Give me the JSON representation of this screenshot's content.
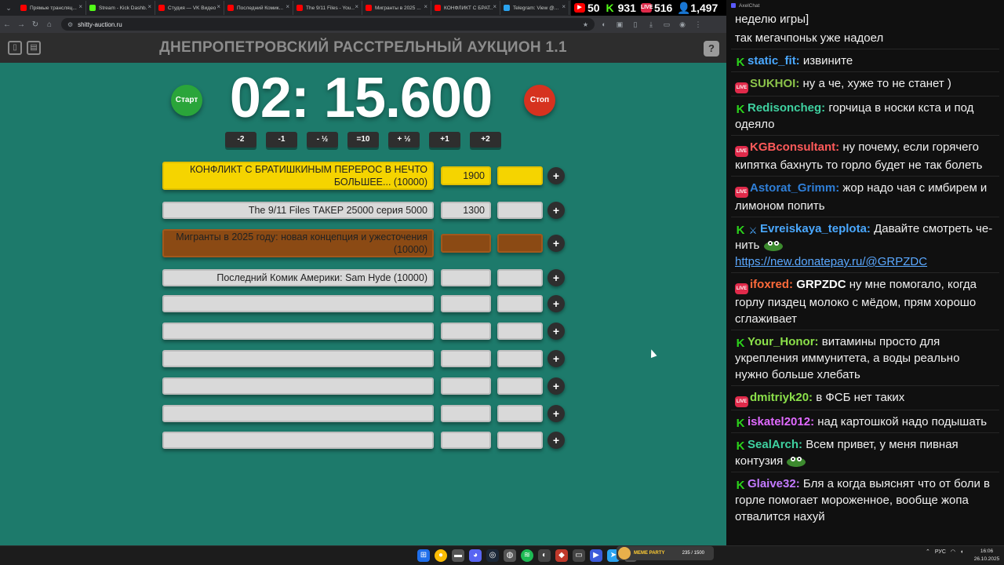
{
  "browser": {
    "tabs": [
      {
        "label": "Прямые трансляц...",
        "color": "#ff0000"
      },
      {
        "label": "Stream - Kick Dashb...",
        "color": "#53fc18"
      },
      {
        "label": "Студия — VK Видео",
        "color": "#ff0000"
      },
      {
        "label": "Последний Комик...",
        "color": "#ff0000"
      },
      {
        "label": "The 9/11 Files - You...",
        "color": "#ff0000"
      },
      {
        "label": "Мигранты в 2025 ...",
        "color": "#ff0000"
      },
      {
        "label": "КОНФЛИКТ С БРАТ...",
        "color": "#ff0000"
      },
      {
        "label": "Telegram: View @...",
        "color": "#2aa3ef"
      }
    ],
    "url": "shitty-auction.ru"
  },
  "stream_stats": {
    "youtube": "50",
    "kick": "931",
    "vk": "516",
    "total": "1,497"
  },
  "header": {
    "title": "ДНЕПРОПЕТРОВСКИЙ РАССТРЕЛЬНЫЙ АУКЦИОН 1.1",
    "help": "?"
  },
  "timer": {
    "value": "02: 15.600",
    "start": "Старт",
    "stop": "Стоп",
    "adjust": [
      "-2",
      "-1",
      "- ½",
      "=10",
      "+ ½",
      "+1",
      "+2"
    ]
  },
  "lots": [
    {
      "name": "КОНФЛИКТ С БРАТИШКИНЫМ ПЕРЕРОС В НЕЧТО БОЛЬШЕЕ... (10000)",
      "amount": "1900",
      "style": "yellow"
    },
    {
      "name": "The 9/11 Files ТАКЕР 25000 серия 5000",
      "amount": "1300",
      "style": "gray"
    },
    {
      "name": "Мигранты в 2025 году: новая концепция и ужесточения (10000)",
      "amount": "",
      "style": "brown"
    },
    {
      "name": "Последний Комик Америки: Sam Hyde (10000)",
      "amount": "",
      "style": "gray"
    },
    {
      "name": "",
      "amount": "",
      "style": "gray"
    },
    {
      "name": "",
      "amount": "",
      "style": "gray"
    },
    {
      "name": "",
      "amount": "",
      "style": "gray"
    },
    {
      "name": "",
      "amount": "",
      "style": "gray"
    },
    {
      "name": "",
      "amount": "",
      "style": "gray"
    },
    {
      "name": "",
      "amount": "",
      "style": "gray"
    }
  ],
  "plus_label": "+",
  "chat": {
    "window_title": "AxelChat",
    "messages": [
      {
        "platform": "",
        "nick": "",
        "color": "#ffffff",
        "text": "неделю игры]",
        "cont": true
      },
      {
        "platform": "",
        "nick": "",
        "color": "#ffffff",
        "text": "так мегачпоньк уже надоел",
        "cont": true
      },
      {
        "platform": "kick",
        "nick": "static_fit:",
        "color": "#4aa8ff",
        "text": "извините"
      },
      {
        "platform": "vk",
        "nick": "SUKHOI:",
        "color": "#8bc34a",
        "text": "ну а че, хуже то не станет )"
      },
      {
        "platform": "kick",
        "nick": "Redisoncheg:",
        "color": "#3fd1a0",
        "text": "горчица в носки кста и под одеяло"
      },
      {
        "platform": "vk",
        "nick": "KGBconsultant:",
        "color": "#ff5a5a",
        "text": "ну почему, если горячего кипятка бахнуть то горло будет не так болеть"
      },
      {
        "platform": "vk",
        "nick": "Astorat_Grimm:",
        "color": "#2f7fd8",
        "text": "жор надо чая с имбирем и лимоном попить"
      },
      {
        "platform": "kick",
        "nick": "Evreiskaya_teplota:",
        "color": "#4aa8ff",
        "text": "Давайте смотреть че-нить",
        "emote": true,
        "link": "https://new.donatepay.ru/@GRPZDC",
        "sword": true
      },
      {
        "platform": "vk",
        "nick": "ifoxred:",
        "color": "#ff6a3a",
        "text": "ну мне помогало, когда горлу пиздец молоко с мёдом, прям хорошо сглаживает",
        "mention": "GRPZDC"
      },
      {
        "platform": "kick",
        "nick": "Your_Honor:",
        "color": "#8be04a",
        "text": "витамины просто для укрепления иммунитета, а воды реально нужно больше хлебать"
      },
      {
        "platform": "vk",
        "nick": "dmitriyk20:",
        "color": "#8be04a",
        "text": "в ФСБ нет таких"
      },
      {
        "platform": "kick",
        "nick": "iskatel2012:",
        "color": "#e06aff",
        "text": "над картошкой надо подышать"
      },
      {
        "platform": "kick",
        "nick": "SealArch:",
        "color": "#3fd1a0",
        "text": "Всем привет, у меня пивная контузия",
        "emote": true
      },
      {
        "platform": "kick",
        "nick": "Glaive32:",
        "color": "#c37aff",
        "text": "Бля а когда выяснят что от боли в горле помогает мороженное, вообще жопа отвалится нахуй"
      }
    ]
  },
  "taskbar": {
    "widget_title": "MEME PARTY",
    "widget_count": "235 / 1500",
    "lang": "РУС",
    "time": "16:06",
    "date": "26.10.2025"
  }
}
